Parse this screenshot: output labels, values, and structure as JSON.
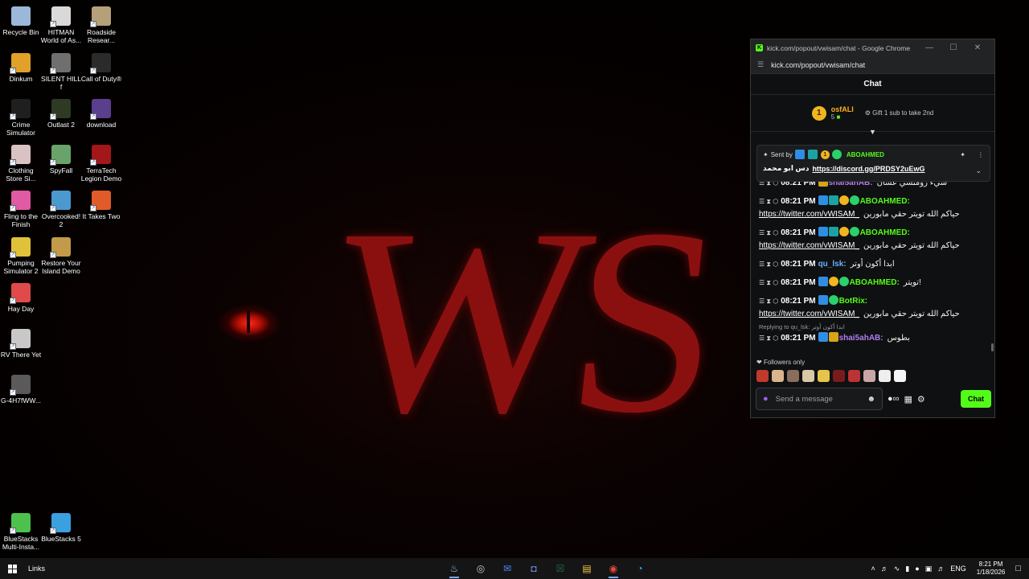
{
  "desktop": {
    "icons": [
      {
        "label": "Recycle Bin",
        "icon": "recycle-bin-icon",
        "color": "#9bb8d8"
      },
      {
        "label": "HITMAN World of As...",
        "icon": "hitman-icon",
        "color": "#d9d9d9"
      },
      {
        "label": "Roadside Resear...",
        "icon": "roadside-research-icon",
        "color": "#b6a07a"
      },
      {
        "label": "Dinkum",
        "icon": "dinkum-icon",
        "color": "#e0a02a"
      },
      {
        "label": "SILENT HILL f",
        "icon": "silent-hill-icon",
        "color": "#6f6f6f"
      },
      {
        "label": "Call of Duty®",
        "icon": "call-of-duty-icon",
        "color": "#2b2b2b"
      },
      {
        "label": "Crime Simulator",
        "icon": "crime-simulator-icon",
        "color": "#1f1f1f"
      },
      {
        "label": "Outlast 2",
        "icon": "outlast-icon",
        "color": "#2e3a24"
      },
      {
        "label": "download",
        "icon": "download-icon",
        "color": "#5a3f8f"
      },
      {
        "label": "Clothing Store Si...",
        "icon": "clothing-store-icon",
        "color": "#d8c2c2"
      },
      {
        "label": "SpyFall",
        "icon": "spyfall-icon",
        "color": "#6aa36a"
      },
      {
        "label": "TerraTech Legion Demo",
        "icon": "terratech-icon",
        "color": "#a3161a"
      },
      {
        "label": "Fling to the Finish",
        "icon": "fling-icon",
        "color": "#e05aa4"
      },
      {
        "label": "Overcooked! 2",
        "icon": "overcooked-icon",
        "color": "#4a9ad0"
      },
      {
        "label": "It Takes Two",
        "icon": "it-takes-two-icon",
        "color": "#e05a2a"
      },
      {
        "label": "Pumping Simulator 2",
        "icon": "pumping-simulator-icon",
        "color": "#e0c23a"
      },
      {
        "label": "Restore Your Island Demo",
        "icon": "restore-island-icon",
        "color": "#c29a4a"
      },
      {
        "label": "Hay Day",
        "icon": "hay-day-icon",
        "color": "#e04a4a"
      },
      {
        "label": "RV There Yet",
        "icon": "rv-there-yet-icon",
        "color": "#c8c8c8"
      },
      {
        "label": "G-4H7fWW...",
        "icon": "image-file-icon",
        "color": "#5a5a5a"
      },
      {
        "label": "BlueStacks Multi-Insta...",
        "icon": "bluestacks-multi-icon",
        "color": "#4cc24c"
      },
      {
        "label": "BlueStacks 5",
        "icon": "bluestacks-icon",
        "color": "#3aa0e0"
      }
    ]
  },
  "window": {
    "title": "kick.com/popout/vwisam/chat - Google Chrome",
    "url": "kick.com/popout/vwisam/chat",
    "controls": {
      "minimize": "—",
      "maximize": "☐",
      "close": "✕"
    }
  },
  "chat": {
    "header": "Chat",
    "top_gifter": {
      "name": "osfALI",
      "rank": "1",
      "count": "5",
      "hint": "Gift 1 sub to take 2nd"
    },
    "pinned": {
      "sent_by_label": "Sent by",
      "author": "ABOAHMED",
      "prefix": "دس ابو محمد",
      "link": "https://discord.gg/PRDSY2uEwG"
    },
    "messages": [
      {
        "time": "08:21 PM",
        "user": "shai5ahAB:",
        "user_color": "#b07ef0",
        "badges": [
          "crown"
        ],
        "text": "شيء رومنسي عشان",
        "link": ""
      },
      {
        "time": "08:21 PM",
        "user": "ABOAHMED:",
        "user_color": "#53fc18",
        "badges": [
          "blue",
          "teal",
          "gold",
          "green"
        ],
        "text": "حياكم الله تويتر حقي مابورين",
        "link": "https://twitter.com/vWISAM_"
      },
      {
        "time": "08:21 PM",
        "user": "ABOAHMED:",
        "user_color": "#53fc18",
        "badges": [
          "blue",
          "teal",
          "gold",
          "green"
        ],
        "text": "حياكم الله تويتر حقي مابورين",
        "link": "https://twitter.com/vWISAM_"
      },
      {
        "time": "08:21 PM",
        "user": "qu_lsk:",
        "user_color": "#6ab0ff",
        "badges": [],
        "text": "ابدا أكون أوتر",
        "link": ""
      },
      {
        "time": "08:21 PM",
        "user": "ABOAHMED:",
        "user_color": "#53fc18",
        "badges": [
          "blue",
          "gold",
          "green"
        ],
        "text": "تويتر!",
        "link": ""
      },
      {
        "time": "08:21 PM",
        "user": "BotRix:",
        "user_color": "#53fc18",
        "badges": [
          "blue",
          "green"
        ],
        "text": "حياكم الله تويتر حقي مابورين",
        "link": "https://twitter.com/vWISAM_"
      },
      {
        "time": "08:21 PM",
        "user": "shai5ahAB:",
        "user_color": "#b07ef0",
        "badges": [
          "blue",
          "crown"
        ],
        "text": "بطوس",
        "link": "",
        "reply_to": "Replying to qu_lsk: ابدا أكون أوتر"
      }
    ],
    "followers_only": "Followers only",
    "emote_colors": [
      "#c0392b",
      "#d9b48c",
      "#8a6d5a",
      "#d8c8a8",
      "#e6c34a",
      "#7a1b1b",
      "#b33",
      "#c9a6a6",
      "#eee",
      "#f5f5f5"
    ],
    "composer": {
      "placeholder": "Send a message",
      "send_label": "Chat"
    }
  },
  "taskbar": {
    "links_label": "Links",
    "apps": [
      {
        "icon": "steam-icon",
        "glyph": "♨",
        "color": "#9fc4f4",
        "active": true
      },
      {
        "icon": "app-icon",
        "glyph": "◎",
        "color": "#c8c8c8",
        "active": false
      },
      {
        "icon": "mail-icon",
        "glyph": "✉",
        "color": "#4a8cff",
        "active": false
      },
      {
        "icon": "discord-icon",
        "glyph": "◘",
        "color": "#7289da",
        "active": false
      },
      {
        "icon": "excel-icon",
        "glyph": "☒",
        "color": "#1d6f42",
        "active": false
      },
      {
        "icon": "file-explorer-icon",
        "glyph": "▤",
        "color": "#f4c542",
        "active": false
      },
      {
        "icon": "chrome-icon",
        "glyph": "◉",
        "color": "#e8453c",
        "active": true
      },
      {
        "icon": "edge-icon",
        "glyph": "◔",
        "color": "#2ab5e8",
        "active": false
      }
    ],
    "tray": {
      "language": "ENG",
      "time": "8:21 PM",
      "date": "1/18/2026"
    }
  }
}
